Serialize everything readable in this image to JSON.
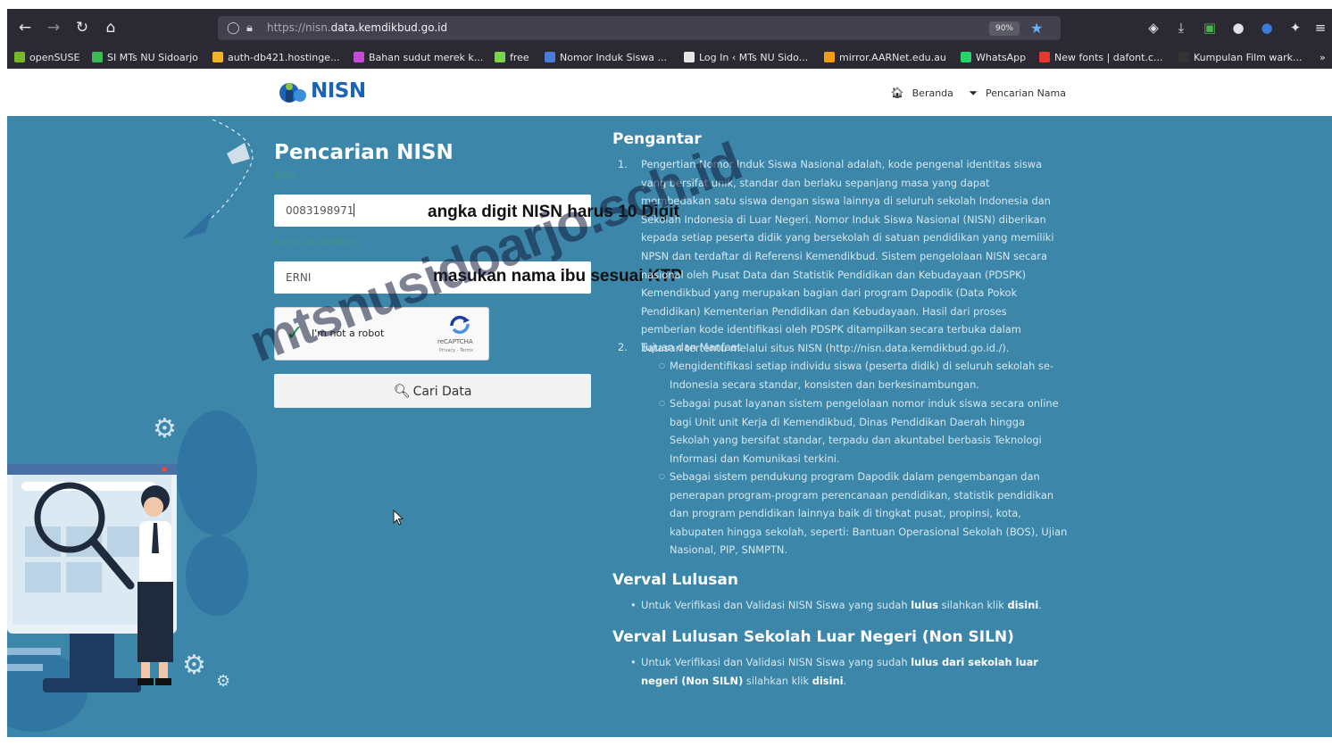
{
  "browser": {
    "url_prefix": "https://nisn.",
    "url_domain": "data.kemdikbud.go.id",
    "zoom": "90%",
    "bookmarks": [
      {
        "label": "openSUSE",
        "color": "#73ba25"
      },
      {
        "label": "SI MTs NU Sidoarjo",
        "color": "#3cba54"
      },
      {
        "label": "auth-db421.hostinge...",
        "color": "#f0b429"
      },
      {
        "label": "Bahan sudut merek k...",
        "color": "#c44bd6"
      },
      {
        "label": "free",
        "color": "#7bd34a"
      },
      {
        "label": "Nomor Induk Siswa ...",
        "color": "#4a7bd6"
      },
      {
        "label": "Log In ‹ MTs NU Sido...",
        "color": "#e6e6e6"
      },
      {
        "label": "mirror.AARNet.edu.au",
        "color": "#f39c12"
      },
      {
        "label": "WhatsApp",
        "color": "#25d366"
      },
      {
        "label": "New fonts | dafont.c...",
        "color": "#e53935"
      },
      {
        "label": "Kumpulan Film wark...",
        "color": "#333333"
      }
    ]
  },
  "header": {
    "logo": "NISN",
    "nav": [
      {
        "label": "Beranda"
      },
      {
        "label": "Pencarian Nama"
      }
    ]
  },
  "form": {
    "title": "Pencarian NISN",
    "nisn_value": "0083198971",
    "nisn_annotation": "angka digit NISN harus 10 Digit",
    "mother_value": "ERNI",
    "mother_annotation": "masukan nama ibu sesuai KTP",
    "captcha_label": "I'm not a robot",
    "captcha_brand": "reCAPTCHA",
    "captcha_links": "Privacy - Terms",
    "search_label": "Cari Data"
  },
  "watermark": "mtsnusidoarjo.sch.id",
  "info": {
    "intro_title": "Pengantar",
    "item1_num": "1.",
    "item1_text": "Pengertian Nomor Induk Siswa Nasional adalah, kode pengenal identitas siswa yang bersifat unik, standar dan berlaku sepanjang masa yang dapat membedakan satu siswa dengan siswa lainnya di seluruh sekolah Indonesia dan Sekolah Indonesia di Luar Negeri. Nomor Induk Siswa Nasional (NISN) diberikan kepada setiap peserta didik yang bersekolah di satuan pendidikan yang memiliki NPSN dan terdaftar di Referensi Kemendikbud. Sistem pengelolaan NISN secara nasional oleh Pusat Data dan Statistik Pendidikan dan Kebudayaan (PDSPK) Kemendikbud yang merupakan bagian dari program Dapodik (Data Pokok Pendidikan) Kementerian Pendidikan dan Kebudayaan. Hasil dari proses pemberian kode identifikasi oleh PDSPK ditampilkan secara terbuka dalam batasan tertentu melalui situs NISN (http://nisn.data.kemdikbud.go.id./).",
    "item2_num": "2.",
    "item2_title": "Tujuan dan Manfaat",
    "sub1": "Mengidentifikasi setiap individu siswa (peserta didik) di seluruh sekolah se-Indonesia secara standar, konsisten dan berkesinambungan.",
    "sub2": "Sebagai pusat layanan sistem pengelolaan nomor induk siswa secara online bagi Unit unit Kerja di Kemendikbud, Dinas Pendidikan Daerah hingga Sekolah yang bersifat standar, terpadu dan akuntabel berbasis Teknologi Informasi dan Komunikasi terkini.",
    "sub3": "Sebagai sistem pendukung program Dapodik dalam pengembangan dan penerapan program-program perencanaan pendidikan, statistik pendidikan dan program pendidikan lainnya baik di tingkat pusat, propinsi, kota, kabupaten hingga sekolah, seperti: Bantuan Operasional Sekolah (BOS), Ujian Nasional, PIP, SNMPTN.",
    "verval_title": "Verval Lulusan",
    "verval_pre": "Untuk Verifikasi dan Validasi NISN Siswa yang sudah",
    "verval_bold": "lulus",
    "verval_mid": "silahkan klik",
    "verval_link": "disini",
    "siln_title": "Verval Lulusan Sekolah Luar Negeri (Non SILN)",
    "siln_pre": "Untuk Verifikasi dan Validasi NISN Siswa yang sudah",
    "siln_bold": "lulus dari sekolah luar negeri (Non SILN)",
    "siln_mid": "silahkan klik",
    "siln_link": "disini"
  },
  "colors": {
    "main_bg": "#3b86a9",
    "browser_bg": "#2b2a33",
    "logo_blue": "#1b63b8"
  }
}
